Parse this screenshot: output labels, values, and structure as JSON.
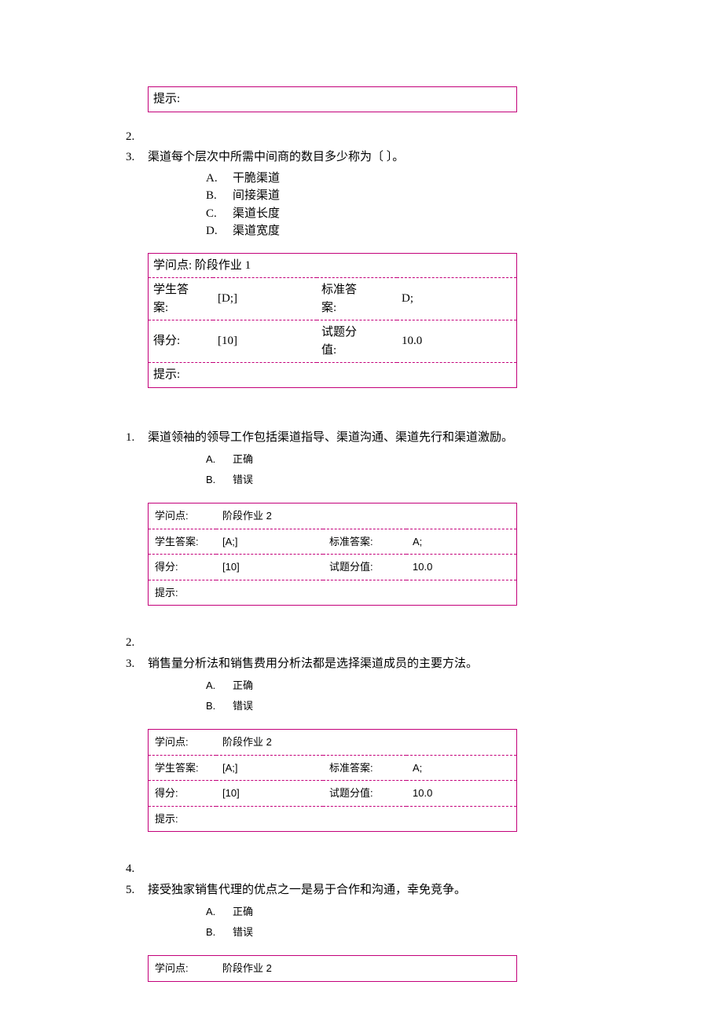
{
  "labels": {
    "hint": "提示:",
    "kp": "学问点:",
    "stu": "学生答案:",
    "std": "标准答案:",
    "score": "得分:",
    "val": "试题分值:"
  },
  "box0": {
    "hint": ""
  },
  "q3": {
    "num": "3.",
    "text": "渠道每个层次中所需中间商的数目多少称为〔 〕。",
    "opts": [
      {
        "l": "A.",
        "t": "干脆渠道"
      },
      {
        "l": "B.",
        "t": "间接渠道"
      },
      {
        "l": "C.",
        "t": "渠道长度"
      },
      {
        "l": "D.",
        "t": "渠道宽度"
      }
    ],
    "box": {
      "kp": "阶段作业 1",
      "stu": "[D;]",
      "std": "D;",
      "score": "[10]",
      "val": "10.0",
      "hint": ""
    }
  },
  "q2_empty": "2.",
  "s2": {
    "q1": {
      "num": "1.",
      "text": "渠道领袖的领导工作包括渠道指导、渠道沟通、渠道先行和渠道激励。",
      "opts": [
        {
          "l": "A.",
          "t": "正确"
        },
        {
          "l": "B.",
          "t": "错误"
        }
      ],
      "box": {
        "kp": "阶段作业 2",
        "stu": "[A;]",
        "std": "A;",
        "score": "[10]",
        "val": "10.0",
        "hint": ""
      }
    },
    "n2": "2.",
    "q3": {
      "num": "3.",
      "text": "销售量分析法和销售费用分析法都是选择渠道成员的主要方法。",
      "opts": [
        {
          "l": "A.",
          "t": "正确"
        },
        {
          "l": "B.",
          "t": "错误"
        }
      ],
      "box": {
        "kp": "阶段作业 2",
        "stu": "[A;]",
        "std": "A;",
        "score": "[10]",
        "val": "10.0",
        "hint": ""
      }
    },
    "n4": "4.",
    "q5": {
      "num": "5.",
      "text": "接受独家销售代理的优点之一是易于合作和沟通，幸免竞争。",
      "opts": [
        {
          "l": "A.",
          "t": "正确"
        },
        {
          "l": "B.",
          "t": "错误"
        }
      ],
      "box": {
        "kp": "阶段作业 2"
      }
    }
  }
}
